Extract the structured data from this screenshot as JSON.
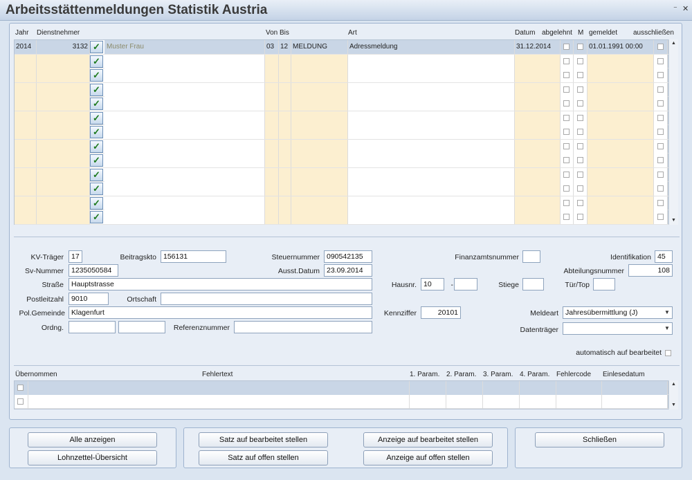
{
  "window": {
    "title": "Arbeitsstättenmeldungen Statistik Austria",
    "min_icon": "minimize-icon",
    "close_icon": "close-icon",
    "min_glyph": "⁻",
    "close_glyph": "✕"
  },
  "grid": {
    "headers": {
      "jahr": "Jahr",
      "dienstnehmer": "Dienstnehmer",
      "von": "Von",
      "bis": "Bis",
      "art": "Art",
      "datum": "Datum",
      "abgelehnt": "abgelehnt",
      "m": "M",
      "gemeldet": "gemeldet",
      "ausschliessen": "ausschließen"
    },
    "first_row": {
      "jahr": "2014",
      "dn_nr": "3132",
      "name": "Muster Frau",
      "von": "03",
      "bis": "12",
      "art_code": "MELDUNG",
      "art": "Adressmeldung",
      "datum": "31.12.2014",
      "gemeldet": "01.01.1991 00:00"
    },
    "row_count": 13
  },
  "form": {
    "kv_traeger": {
      "label": "KV-Träger",
      "value": "17"
    },
    "beitragskto": {
      "label": "Beitragskto",
      "value": "156131"
    },
    "steuernummer": {
      "label": "Steuernummer",
      "value": "090542135"
    },
    "finanzamtsnummer": {
      "label": "Finanzamtsnummer",
      "value": ""
    },
    "identifikation": {
      "label": "Identifikation",
      "value": "45"
    },
    "sv_nummer": {
      "label": "Sv-Nummer",
      "value": "1235050584"
    },
    "ausst_datum": {
      "label": "Ausst.Datum",
      "value": "23.09.2014"
    },
    "abteilungsnummer": {
      "label": "Abteilungsnummer",
      "value": "108"
    },
    "strasse": {
      "label": "Straße",
      "value": "Hauptstrasse"
    },
    "hausnr": {
      "label": "Hausnr.",
      "value": "10",
      "sep": "-",
      "value2": ""
    },
    "stiege": {
      "label": "Stiege",
      "value": ""
    },
    "tuer_top": {
      "label": "Tür/Top",
      "value": ""
    },
    "postleitzahl": {
      "label": "Postleitzahl",
      "value": "9010"
    },
    "ortschaft": {
      "label": "Ortschaft",
      "value": ""
    },
    "pol_gemeinde": {
      "label": "Pol.Gemeinde",
      "value": "Klagenfurt"
    },
    "kennziffer": {
      "label": "Kennziffer",
      "value": "20101"
    },
    "meldeart": {
      "label": "Meldeart",
      "value": "Jahresübermittlung (J)"
    },
    "ordng": {
      "label": "Ordng.",
      "value": "",
      "value2": ""
    },
    "referenznummer": {
      "label": "Referenznummer",
      "value": ""
    },
    "datentraeger": {
      "label": "Datenträger",
      "value": ""
    },
    "automatisch": {
      "label": "automatisch auf bearbeitet"
    }
  },
  "errors": {
    "headers": {
      "uebernommen": "Übernommen",
      "fehlertext": "Fehlertext",
      "p1": "1. Param.",
      "p2": "2. Param.",
      "p3": "3. Param.",
      "p4": "4. Param.",
      "fehlercode": "Fehlercode",
      "einlesedatum": "Einlesedatum"
    }
  },
  "buttons": {
    "alle_anzeigen": "Alle anzeigen",
    "lohnzettel": "Lohnzettel-Übersicht",
    "satz_bearbeitet": "Satz auf bearbeitet stellen",
    "satz_offen": "Satz auf offen stellen",
    "anzeige_bearbeitet": "Anzeige auf bearbeitet stellen",
    "anzeige_offen": "Anzeige auf offen stellen",
    "schliessen": "Schließen"
  },
  "colors": {
    "accent": "#c9d6e6",
    "field_yellow": "#fcefd0",
    "background": "#dbe5f1"
  }
}
